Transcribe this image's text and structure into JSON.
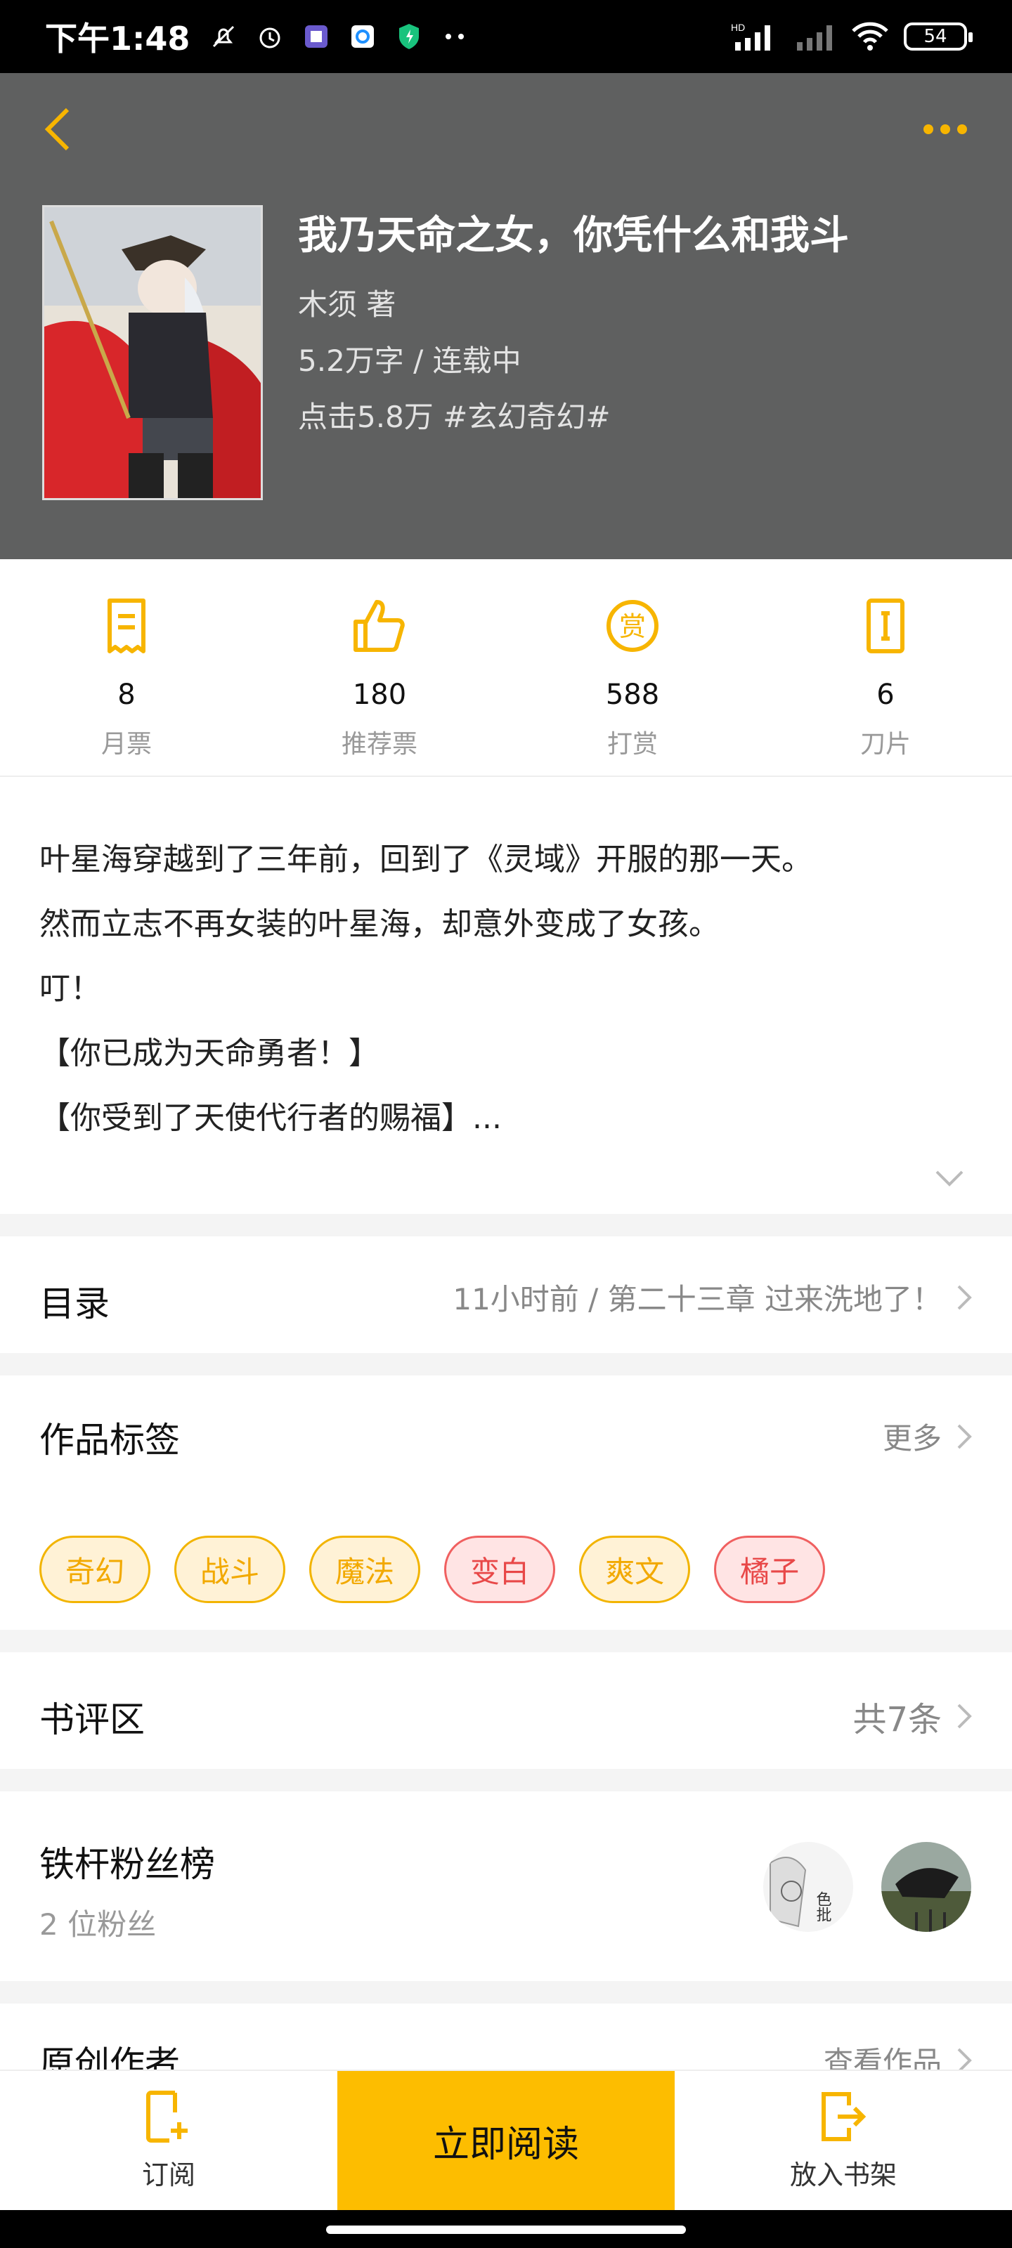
{
  "status_bar": {
    "time": "下午1:48",
    "battery": "54",
    "network": "HD"
  },
  "book": {
    "title": "我乃天命之女，你凭什么和我斗",
    "author": "木须  著",
    "words_status": "5.2万字 / 连载中",
    "meta": "点击5.8万  #玄幻奇幻#"
  },
  "stats": [
    {
      "icon": "ticket-icon",
      "value": "8",
      "label": "月票"
    },
    {
      "icon": "thumbs-up-icon",
      "value": "180",
      "label": "推荐票"
    },
    {
      "icon": "reward-icon",
      "value": "588",
      "label": "打赏"
    },
    {
      "icon": "blade-icon",
      "value": "6",
      "label": "刀片"
    }
  ],
  "synopsis": [
    "叶星海穿越到了三年前，回到了《灵域》开服的那一天。",
    "然而立志不再女装的叶星海，却意外变成了女孩。",
    "叮！",
    "【你已成为天命勇者！】",
    "【你受到了天使代行者的赐福】..."
  ],
  "toc": {
    "title": "目录",
    "latest": "11小时前 / 第二十三章 过来洗地了！"
  },
  "tags": {
    "title": "作品标签",
    "more": "更多",
    "items": [
      {
        "label": "奇幻",
        "style": "yellow"
      },
      {
        "label": "战斗",
        "style": "yellow"
      },
      {
        "label": "魔法",
        "style": "yellow"
      },
      {
        "label": "变白",
        "style": "red"
      },
      {
        "label": "爽文",
        "style": "yellow"
      },
      {
        "label": "橘子",
        "style": "red"
      }
    ]
  },
  "reviews": {
    "title": "书评区",
    "count": "共7条"
  },
  "fans": {
    "title": "铁杆粉丝榜",
    "count": "2 位粉丝",
    "avatar_text": "色批"
  },
  "authors": {
    "title": "原创作者",
    "link": "查看作品"
  },
  "bottom_bar": {
    "subscribe": "订阅",
    "read_now": "立即阅读",
    "add_shelf": "放入书架"
  },
  "colors": {
    "accent": "#fdbd00",
    "header_bg": "#5f6060"
  }
}
